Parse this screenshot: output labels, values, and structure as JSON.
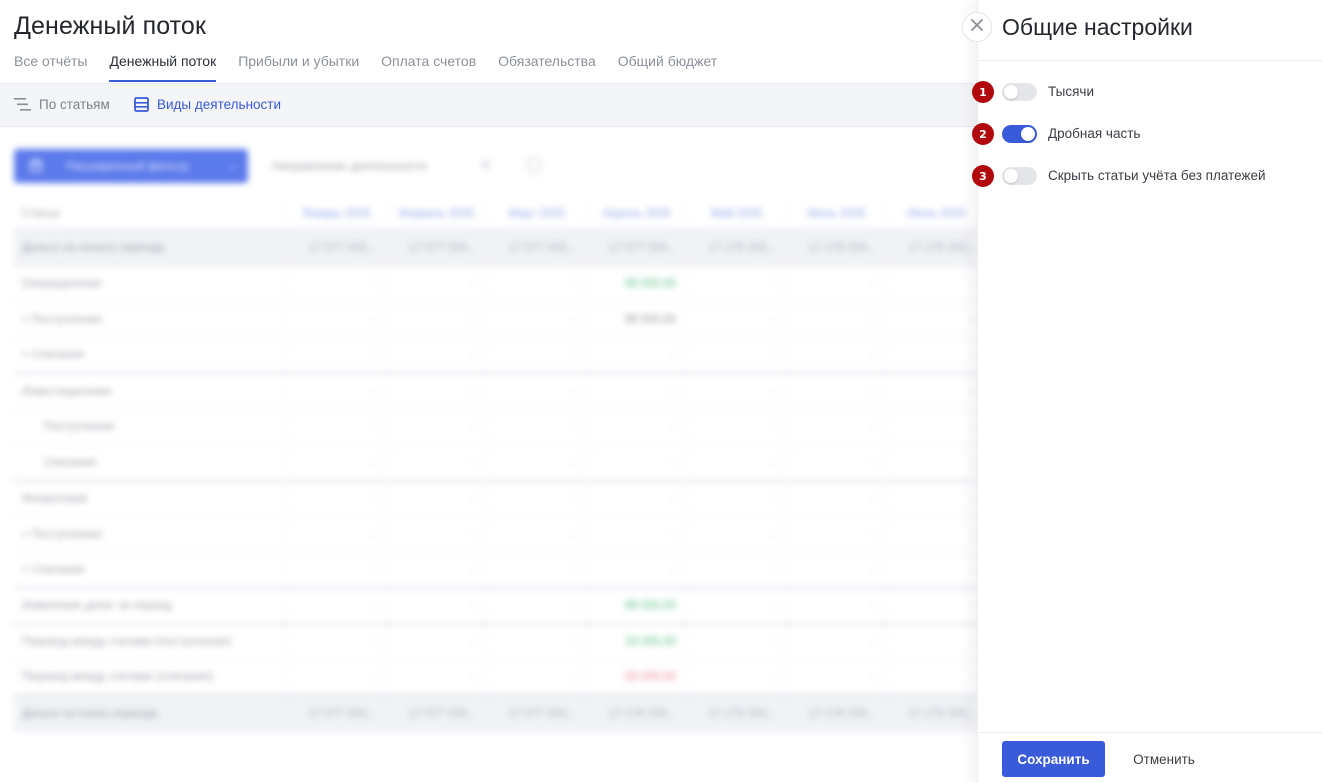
{
  "page": {
    "title": "Денежный поток",
    "tabs": [
      {
        "label": "Все отчёты"
      },
      {
        "label": "Денежный поток",
        "active": true
      },
      {
        "label": "Прибыли и убытки"
      },
      {
        "label": "Оплата счетов"
      },
      {
        "label": "Обязательства"
      },
      {
        "label": "Общий бюджет"
      }
    ],
    "subnav": {
      "by_items": "По статьям",
      "by_activity": "Виды деятельности"
    }
  },
  "report": {
    "filter_label": "Расширенный фильтр",
    "direction_label": "Направление деятельности",
    "columns": [
      "Статьи",
      "Январь 2025",
      "Февраль 2025",
      "Март 2025",
      "Апрель 2025",
      "Май 2025",
      "Июнь 2025",
      "Июль 2025"
    ],
    "rows": [
      {
        "name": "Деньги на начало периода",
        "kind": "shade",
        "cells": [
          "17 077 333...",
          "17 077 333...",
          "17 077 333...",
          "17 077 333...",
          "17 178 333...",
          "17 178 333...",
          "17 178 333..."
        ]
      },
      {
        "name": "Операционная",
        "kind": "",
        "cells": [
          "-",
          "-",
          "-",
          "99 000,00",
          "-",
          "-",
          "-"
        ],
        "tone": [
          0,
          0,
          0,
          "pos",
          0,
          0,
          0
        ]
      },
      {
        "name": "+ Поступления",
        "kind": "",
        "cells": [
          "-",
          "-",
          "-",
          "99 000,00",
          "-",
          "-",
          "-"
        ],
        "tone": [
          0,
          0,
          0,
          "dark",
          0,
          0,
          0
        ]
      },
      {
        "name": "+ Списания",
        "kind": "sep",
        "cells": [
          "-",
          "-",
          "-",
          "-",
          "-",
          "-",
          "-"
        ]
      },
      {
        "name": "Инвестиционная",
        "kind": "",
        "cells": [
          "-",
          "-",
          "-",
          "-",
          "-",
          "-",
          "-"
        ]
      },
      {
        "name": "Поступления",
        "kind": "ind",
        "cells": [
          "-",
          "-",
          "-",
          "-",
          "-",
          "-",
          "-"
        ]
      },
      {
        "name": "Списания",
        "kind": "ind sep",
        "cells": [
          "-",
          "-",
          "-",
          "-",
          "-",
          "-",
          "-"
        ]
      },
      {
        "name": "Финансовая",
        "kind": "",
        "cells": [
          "-",
          "-",
          "-",
          "-",
          "-",
          "-",
          "-"
        ]
      },
      {
        "name": "+ Поступления",
        "kind": "",
        "cells": [
          "-",
          "-",
          "-",
          "-",
          "-",
          "-",
          "-"
        ]
      },
      {
        "name": "+ Списания",
        "kind": "sep",
        "cells": [
          "-",
          "-",
          "-",
          "-",
          "-",
          "-",
          "-"
        ]
      },
      {
        "name": "Изменение денег за период",
        "kind": "sep",
        "cells": [
          "-",
          "-",
          "-",
          "99 000,00",
          "-",
          "-",
          "-"
        ],
        "tone": [
          0,
          0,
          0,
          "pos",
          0,
          0,
          0
        ]
      },
      {
        "name": "Перевод между счетами (поступление)",
        "kind": "",
        "cells": [
          "-",
          "-",
          "-",
          "33 000,00",
          "-",
          "-",
          "-"
        ],
        "tone": [
          0,
          0,
          0,
          "pos",
          0,
          0,
          0
        ]
      },
      {
        "name": "Перевод между счетами (списание)",
        "kind": "sep",
        "cells": [
          "-",
          "-",
          "-",
          "-33 000,00",
          "-",
          "-",
          "-"
        ],
        "tone": [
          0,
          0,
          0,
          "neg",
          0,
          0,
          0
        ]
      },
      {
        "name": "Деньги на конец периода",
        "kind": "shade",
        "cells": [
          "17 077 333...",
          "17 077 333...",
          "17 077 333...",
          "17 178 333...",
          "17 178 333...",
          "17 178 333...",
          "17 178 333..."
        ]
      }
    ]
  },
  "settings_panel": {
    "title": "Общие настройки",
    "settings": [
      {
        "badge": "1",
        "label": "Тысячи",
        "enabled": false
      },
      {
        "badge": "2",
        "label": "Дробная часть",
        "enabled": true
      },
      {
        "badge": "3",
        "label": "Скрыть статьи учёта без платежей",
        "enabled": false
      }
    ],
    "save_label": "Сохранить",
    "cancel_label": "Отменить"
  },
  "colors": {
    "accent": "#3a5bd9",
    "badge": "#b0080c",
    "positive": "#3bb36a",
    "negative": "#e46d78"
  },
  "icons": {
    "close": "close-icon",
    "by_items": "list-indent-icon",
    "by_activity": "table-icon",
    "filter": "filter-icon",
    "add": "plus-icon",
    "document": "document-icon"
  }
}
